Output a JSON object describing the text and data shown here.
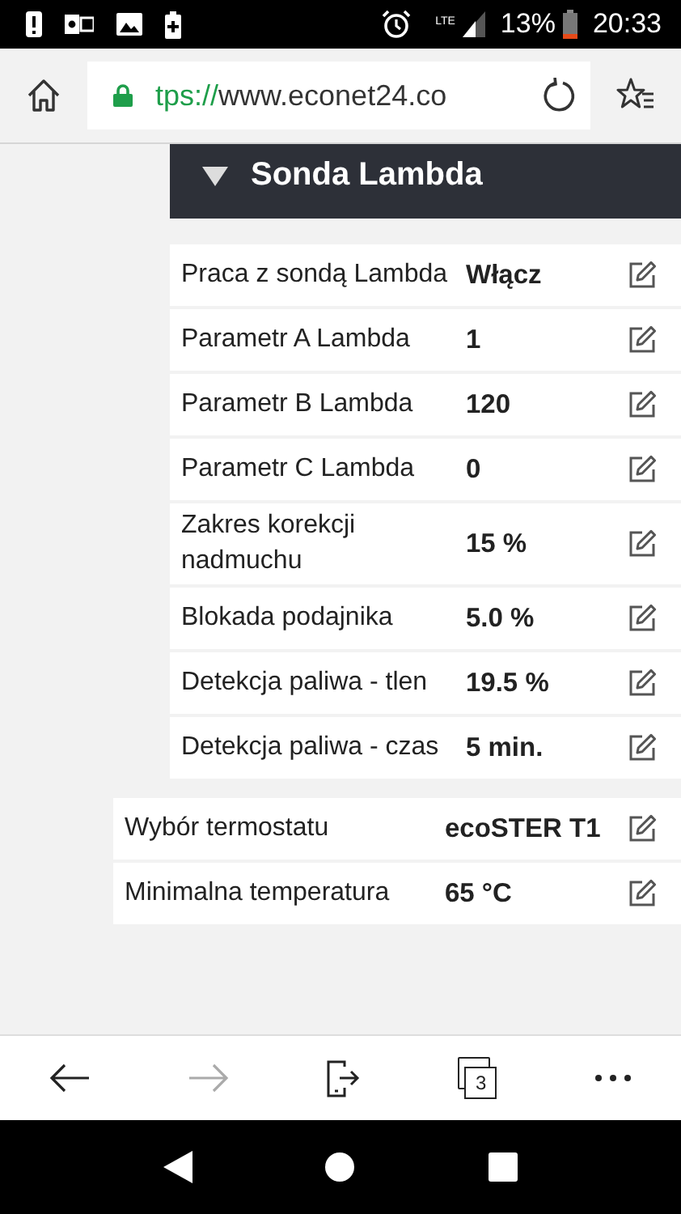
{
  "status_bar": {
    "network": "LTE",
    "battery": "13%",
    "time": "20:33"
  },
  "browser": {
    "url_scheme": "tps://",
    "url_host": "www.econet24.co"
  },
  "section": {
    "title": "Sonda Lambda",
    "expanded": true,
    "rows": [
      {
        "label": "Praca z sondą Lambda",
        "value": "Włącz"
      },
      {
        "label": "Parametr A Lambda",
        "value": "1"
      },
      {
        "label": "Parametr B Lambda",
        "value": "120"
      },
      {
        "label": "Parametr C Lambda",
        "value": "0"
      },
      {
        "label": "Zakres korekcji nadmuchu",
        "value": "15 %"
      },
      {
        "label": "Blokada podajnika",
        "value": "5.0 %"
      },
      {
        "label": "Detekcja paliwa - tlen",
        "value": "19.5 %"
      },
      {
        "label": "Detekcja paliwa - czas",
        "value": "5 min."
      }
    ]
  },
  "settings": [
    {
      "label": "Wybór termostatu",
      "value": "ecoSTER T1"
    },
    {
      "label": "Minimalna temperatura",
      "value": "65 °C"
    }
  ],
  "toolbar": {
    "forward_disabled": true,
    "tab_count": "3"
  }
}
